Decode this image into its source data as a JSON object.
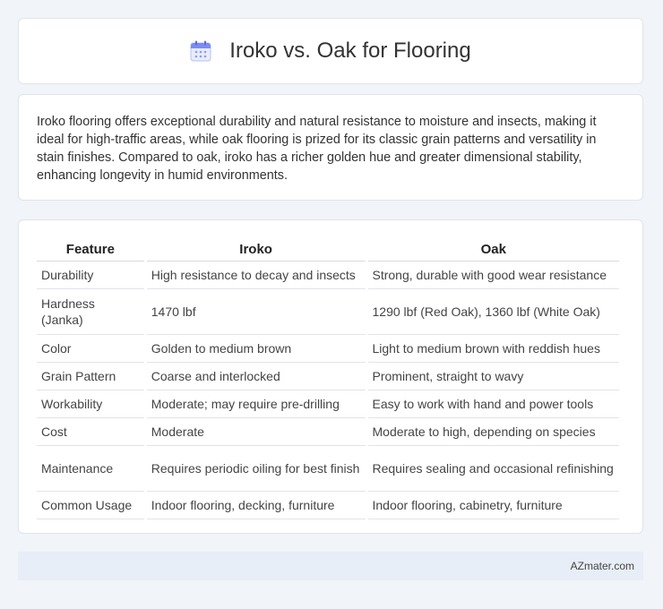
{
  "header": {
    "title": "Iroko vs. Oak for Flooring",
    "icon": "calendar-icon",
    "icon_color": "#6b7ef0"
  },
  "intro": {
    "text": "Iroko flooring offers exceptional durability and natural resistance to moisture and insects, making it ideal for high-traffic areas, while oak flooring is prized for its classic grain patterns and versatility in stain finishes. Compared to oak, iroko has a richer golden hue and greater dimensional stability, enhancing longevity in humid environments."
  },
  "table": {
    "headers": [
      "Feature",
      "Iroko",
      "Oak"
    ],
    "rows": [
      [
        "Durability",
        "High resistance to decay and insects",
        "Strong, durable with good wear resistance"
      ],
      [
        "Hardness (Janka)",
        "1470 lbf",
        "1290 lbf (Red Oak), 1360 lbf (White Oak)"
      ],
      [
        "Color",
        "Golden to medium brown",
        "Light to medium brown with reddish hues"
      ],
      [
        "Grain Pattern",
        "Coarse and interlocked",
        "Prominent, straight to wavy"
      ],
      [
        "Workability",
        "Moderate; may require pre-drilling",
        "Easy to work with hand and power tools"
      ],
      [
        "Cost",
        "Moderate",
        "Moderate to high, depending on species"
      ],
      [
        "Maintenance",
        "Requires periodic oiling for best finish",
        "Requires sealing and occasional refinishing"
      ],
      [
        "Common Usage",
        "Indoor flooring, decking, furniture",
        "Indoor flooring, cabinetry, furniture"
      ]
    ]
  },
  "footer": {
    "text": "AZmater.com"
  }
}
